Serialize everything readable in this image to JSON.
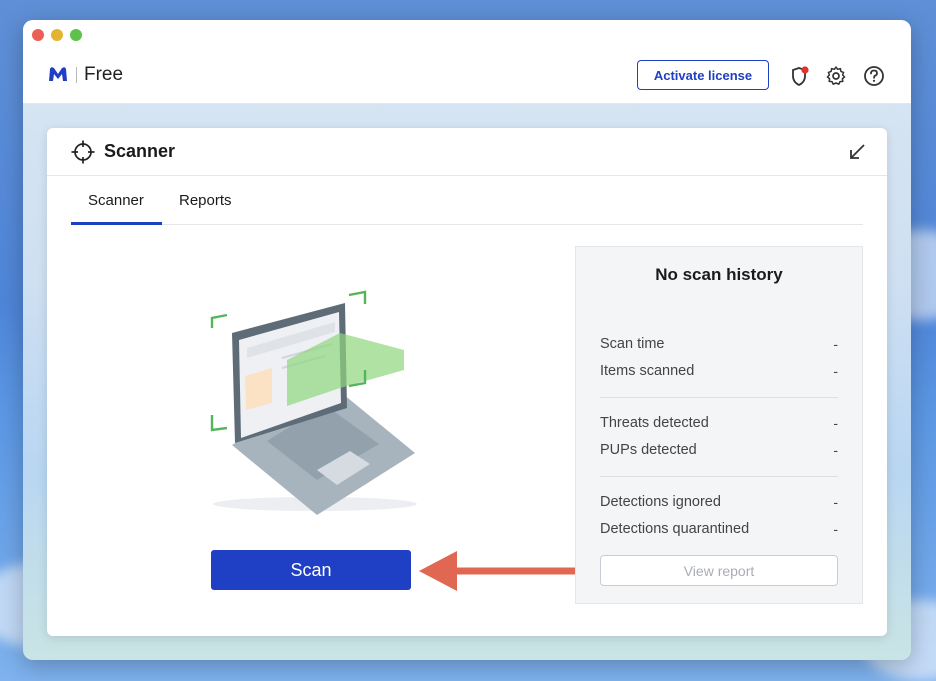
{
  "app": {
    "brand": "Free",
    "activate_label": "Activate license",
    "icons": [
      "malwarebytes-logo-icon",
      "shield-alert-icon",
      "gear-icon",
      "help-icon"
    ],
    "accent_color": "#1f3fc4"
  },
  "panel": {
    "title": "Scanner",
    "tabs": [
      {
        "label": "Scanner",
        "active": true
      },
      {
        "label": "Reports",
        "active": false
      }
    ]
  },
  "scan": {
    "button_label": "Scan"
  },
  "history": {
    "title": "No scan history",
    "stats": [
      {
        "label": "Scan time",
        "value": "-"
      },
      {
        "label": "Items scanned",
        "value": "-"
      },
      {
        "label": "Threats detected",
        "value": "-"
      },
      {
        "label": "PUPs detected",
        "value": "-"
      },
      {
        "label": "Detections ignored",
        "value": "-"
      },
      {
        "label": "Detections quarantined",
        "value": "-"
      }
    ],
    "view_report_label": "View report"
  }
}
